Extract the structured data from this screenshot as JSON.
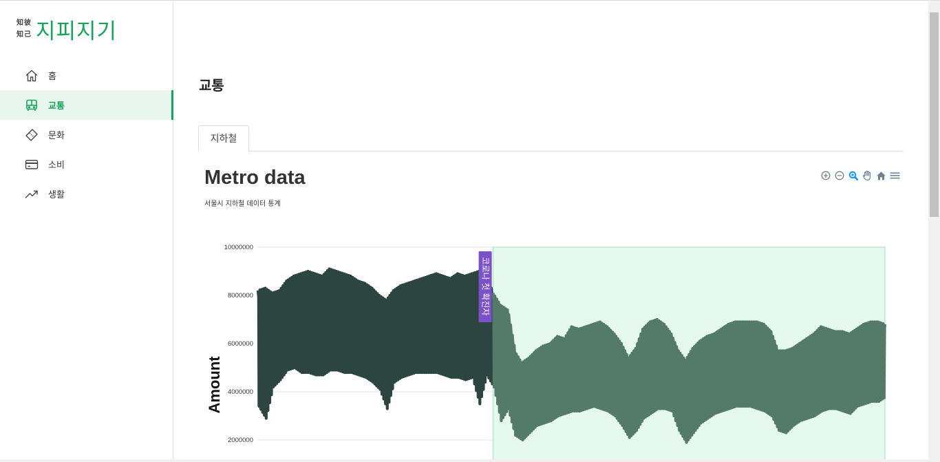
{
  "app": {
    "logo_mark_line1": "知彼",
    "logo_mark_line2": "知己",
    "logo_text": "지피지기"
  },
  "sidebar": {
    "items": [
      {
        "label": "홈",
        "icon": "home-icon"
      },
      {
        "label": "교통",
        "icon": "bus-icon",
        "active": true
      },
      {
        "label": "문화",
        "icon": "ticket-icon"
      },
      {
        "label": "소비",
        "icon": "credit-card-icon"
      },
      {
        "label": "생활",
        "icon": "trending-up-icon"
      }
    ]
  },
  "page": {
    "title": "교통",
    "tabs": [
      {
        "label": "지하철"
      }
    ]
  },
  "toolbar": {
    "icons": [
      "zoom-in-icon",
      "zoom-out-icon",
      "selection-zoom-icon",
      "pan-hand-icon",
      "reset-home-icon",
      "menu-icon"
    ]
  },
  "colors": {
    "accent": "#14a35a",
    "series_before": "#2d4541",
    "series_after": "#547a69",
    "highlight_band": "#e6f9ee",
    "annotation": "#7a51c9"
  },
  "chart_data": {
    "type": "area",
    "title": "Metro data",
    "subtitle": "서울시 지하철 데이터 통계",
    "ylabel": "Amount",
    "ylim": [
      1300000,
      10000000
    ],
    "yticks": [
      2000000,
      4000000,
      6000000,
      8000000,
      10000000
    ],
    "ytick_labels": [
      "2000000",
      "4000000",
      "6000000",
      "8000000",
      "10000000"
    ],
    "grid": true,
    "annotation": {
      "label": "코로나 첫 확진자",
      "at_x": 33
    },
    "highlight_from_x": 33,
    "series": [
      {
        "color": "#2d4541",
        "x": [
          0,
          1,
          2,
          3,
          4,
          5,
          6,
          7,
          8,
          9,
          10,
          11,
          12,
          13,
          14,
          15,
          16,
          17,
          18,
          19,
          20,
          21,
          22,
          23,
          24,
          25,
          26,
          27,
          28,
          29,
          30,
          31,
          32,
          33
        ],
        "high": [
          8200000,
          8300000,
          8100000,
          8200000,
          8600000,
          8800000,
          8900000,
          9000000,
          8900000,
          8800000,
          9100000,
          9000000,
          8900000,
          8800000,
          8600000,
          8500000,
          8300000,
          8000000,
          7800000,
          8200000,
          8400000,
          8500000,
          8600000,
          8700000,
          8800000,
          8900000,
          8800000,
          8700000,
          8900000,
          8800000,
          8900000,
          9000000,
          8900000,
          8100000
        ],
        "low": [
          3400000,
          2900000,
          4200000,
          4500000,
          4900000,
          5000000,
          4800000,
          4800000,
          4700000,
          4700000,
          4900000,
          4900000,
          4800000,
          4800000,
          4700000,
          4600000,
          4400000,
          4100000,
          3300000,
          4400000,
          4600000,
          4700000,
          4800000,
          4800000,
          4800000,
          4800000,
          4700000,
          4600000,
          4600000,
          4500000,
          4600000,
          3500000,
          4700000,
          4200000
        ]
      },
      {
        "color": "#547a69",
        "x": [
          33,
          34,
          35,
          36,
          37,
          38,
          39,
          40,
          41,
          42,
          43,
          44,
          45,
          46,
          47,
          48,
          49,
          50,
          51,
          52,
          53,
          54,
          55,
          56,
          57,
          58,
          59,
          60,
          61,
          62,
          63,
          64,
          65,
          66,
          67,
          68,
          69,
          70,
          71,
          72,
          73,
          74,
          75,
          76,
          77,
          78,
          79,
          80,
          81,
          82,
          83,
          84,
          85,
          86,
          87,
          88
        ],
        "high": [
          8100000,
          7600000,
          7400000,
          5700000,
          5200000,
          5400000,
          5700000,
          5900000,
          6000000,
          6300000,
          6200000,
          6700000,
          6600000,
          6700000,
          6800000,
          6900000,
          6700000,
          6400000,
          6000000,
          5400000,
          5800000,
          6600000,
          6900000,
          7000000,
          6800000,
          6400000,
          5700000,
          5300000,
          5800000,
          6100000,
          6300000,
          6400000,
          6600000,
          6800000,
          6900000,
          6900000,
          6900000,
          6900000,
          6800000,
          6500000,
          5700000,
          5700000,
          5800000,
          6000000,
          6200000,
          6400000,
          6700000,
          6600000,
          6500000,
          6500000,
          6400000,
          6600000,
          6800000,
          6900000,
          6900000,
          6800000
        ],
        "low": [
          4200000,
          2800000,
          3300000,
          2200000,
          2000000,
          2300000,
          2600000,
          2700000,
          2800000,
          3000000,
          3100000,
          3200000,
          3200000,
          3300000,
          3400000,
          3300000,
          3200000,
          3000000,
          2600000,
          2100000,
          2400000,
          2900000,
          3100000,
          3300000,
          3300000,
          3200000,
          2400000,
          1900000,
          2300000,
          2700000,
          2900000,
          3100000,
          3200000,
          3300000,
          3400000,
          3400000,
          3400000,
          3300000,
          3200000,
          3000000,
          2400000,
          2300000,
          2600000,
          2800000,
          2900000,
          3000000,
          3200000,
          3300000,
          3300000,
          3200000,
          3100000,
          3400000,
          3500000,
          3600000,
          3600000,
          3800000
        ]
      }
    ]
  }
}
